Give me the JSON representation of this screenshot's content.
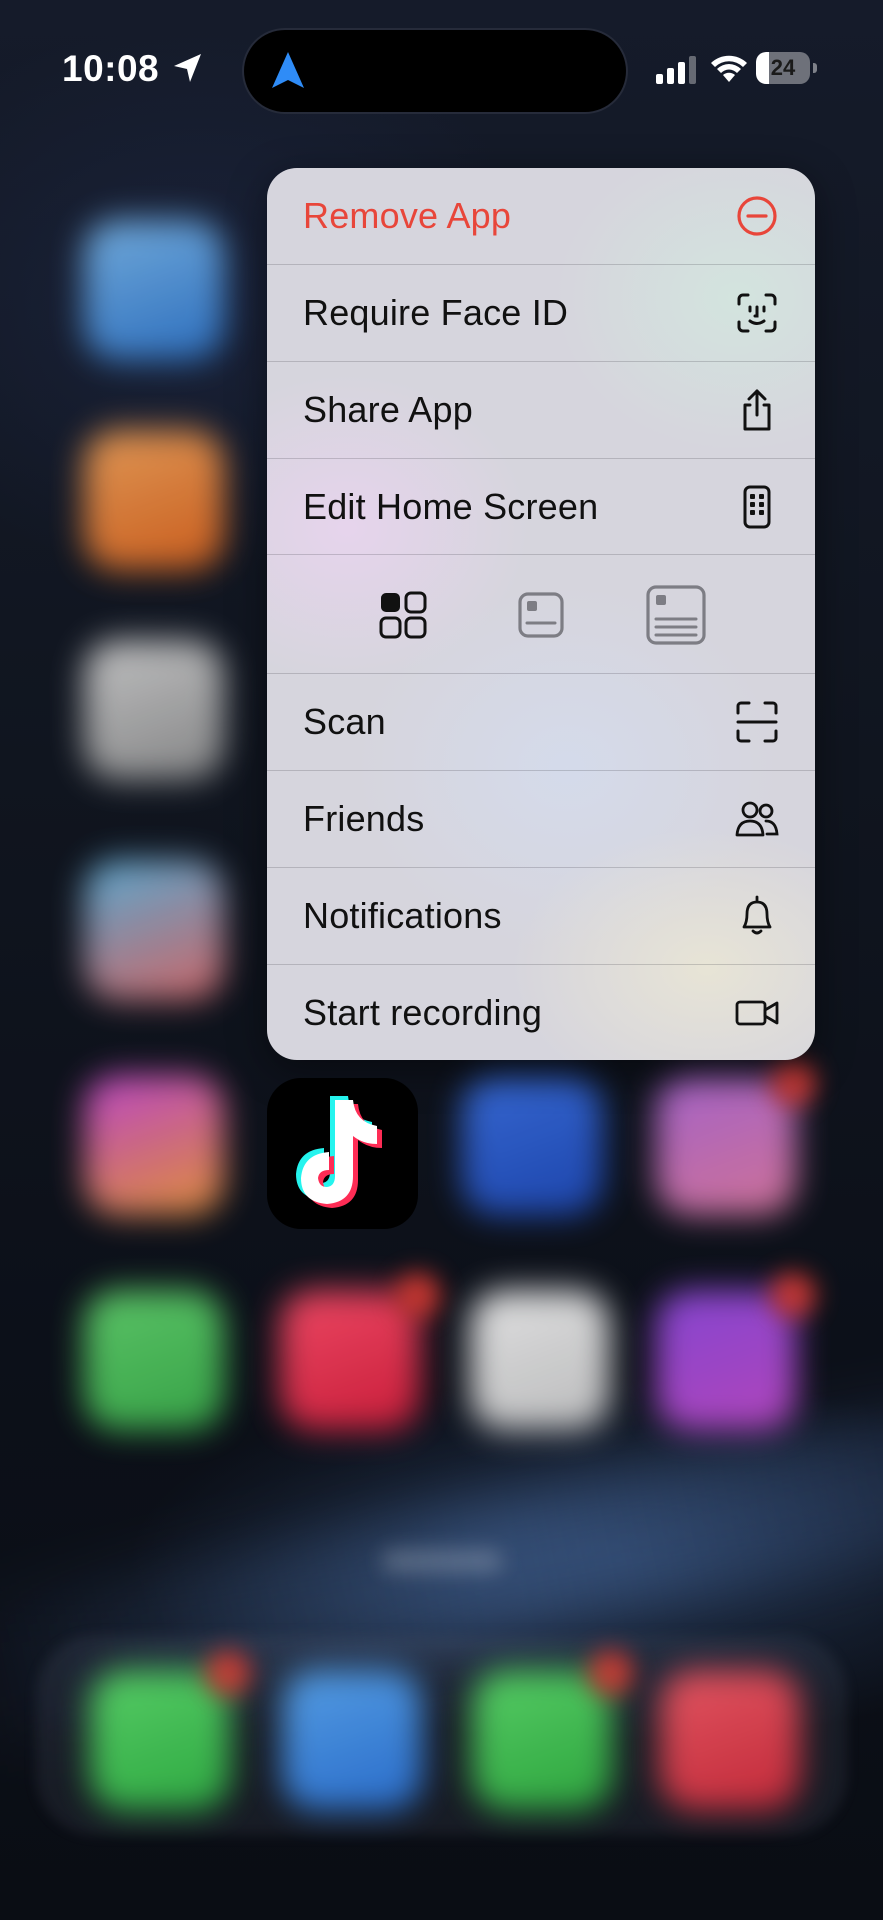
{
  "status_bar": {
    "time": "10:08",
    "battery_level": "24",
    "battery_fraction": 0.24,
    "icons": [
      "location-arrow-icon",
      "navigation-arrow-icon",
      "cellular-signal-icon",
      "wifi-icon",
      "battery-icon"
    ]
  },
  "context_menu": {
    "items": [
      {
        "label": "Remove App",
        "icon": "minus-circle-icon",
        "destructive": true
      },
      {
        "label": "Require Face ID",
        "icon": "face-id-icon"
      },
      {
        "label": "Share App",
        "icon": "share-icon"
      },
      {
        "label": "Edit Home Screen",
        "icon": "phone-apps-icon"
      }
    ],
    "size_options": [
      {
        "icon": "small-icon-grid-icon",
        "selected": true
      },
      {
        "icon": "medium-widget-icon",
        "selected": false
      },
      {
        "icon": "large-widget-icon",
        "selected": false
      }
    ],
    "app_actions": [
      {
        "label": "Scan",
        "icon": "scan-frame-icon"
      },
      {
        "label": "Friends",
        "icon": "friends-icon"
      },
      {
        "label": "Notifications",
        "icon": "bell-icon"
      },
      {
        "label": "Start recording",
        "icon": "video-camera-icon"
      }
    ]
  },
  "app": {
    "icon": "tiktok-icon"
  },
  "colors": {
    "destructive": "#e8463a",
    "menu_text": "#111111",
    "nav_arrow": "#2f8cf7",
    "tiktok_cyan": "#25f4ee",
    "tiktok_red": "#fe2c55"
  }
}
